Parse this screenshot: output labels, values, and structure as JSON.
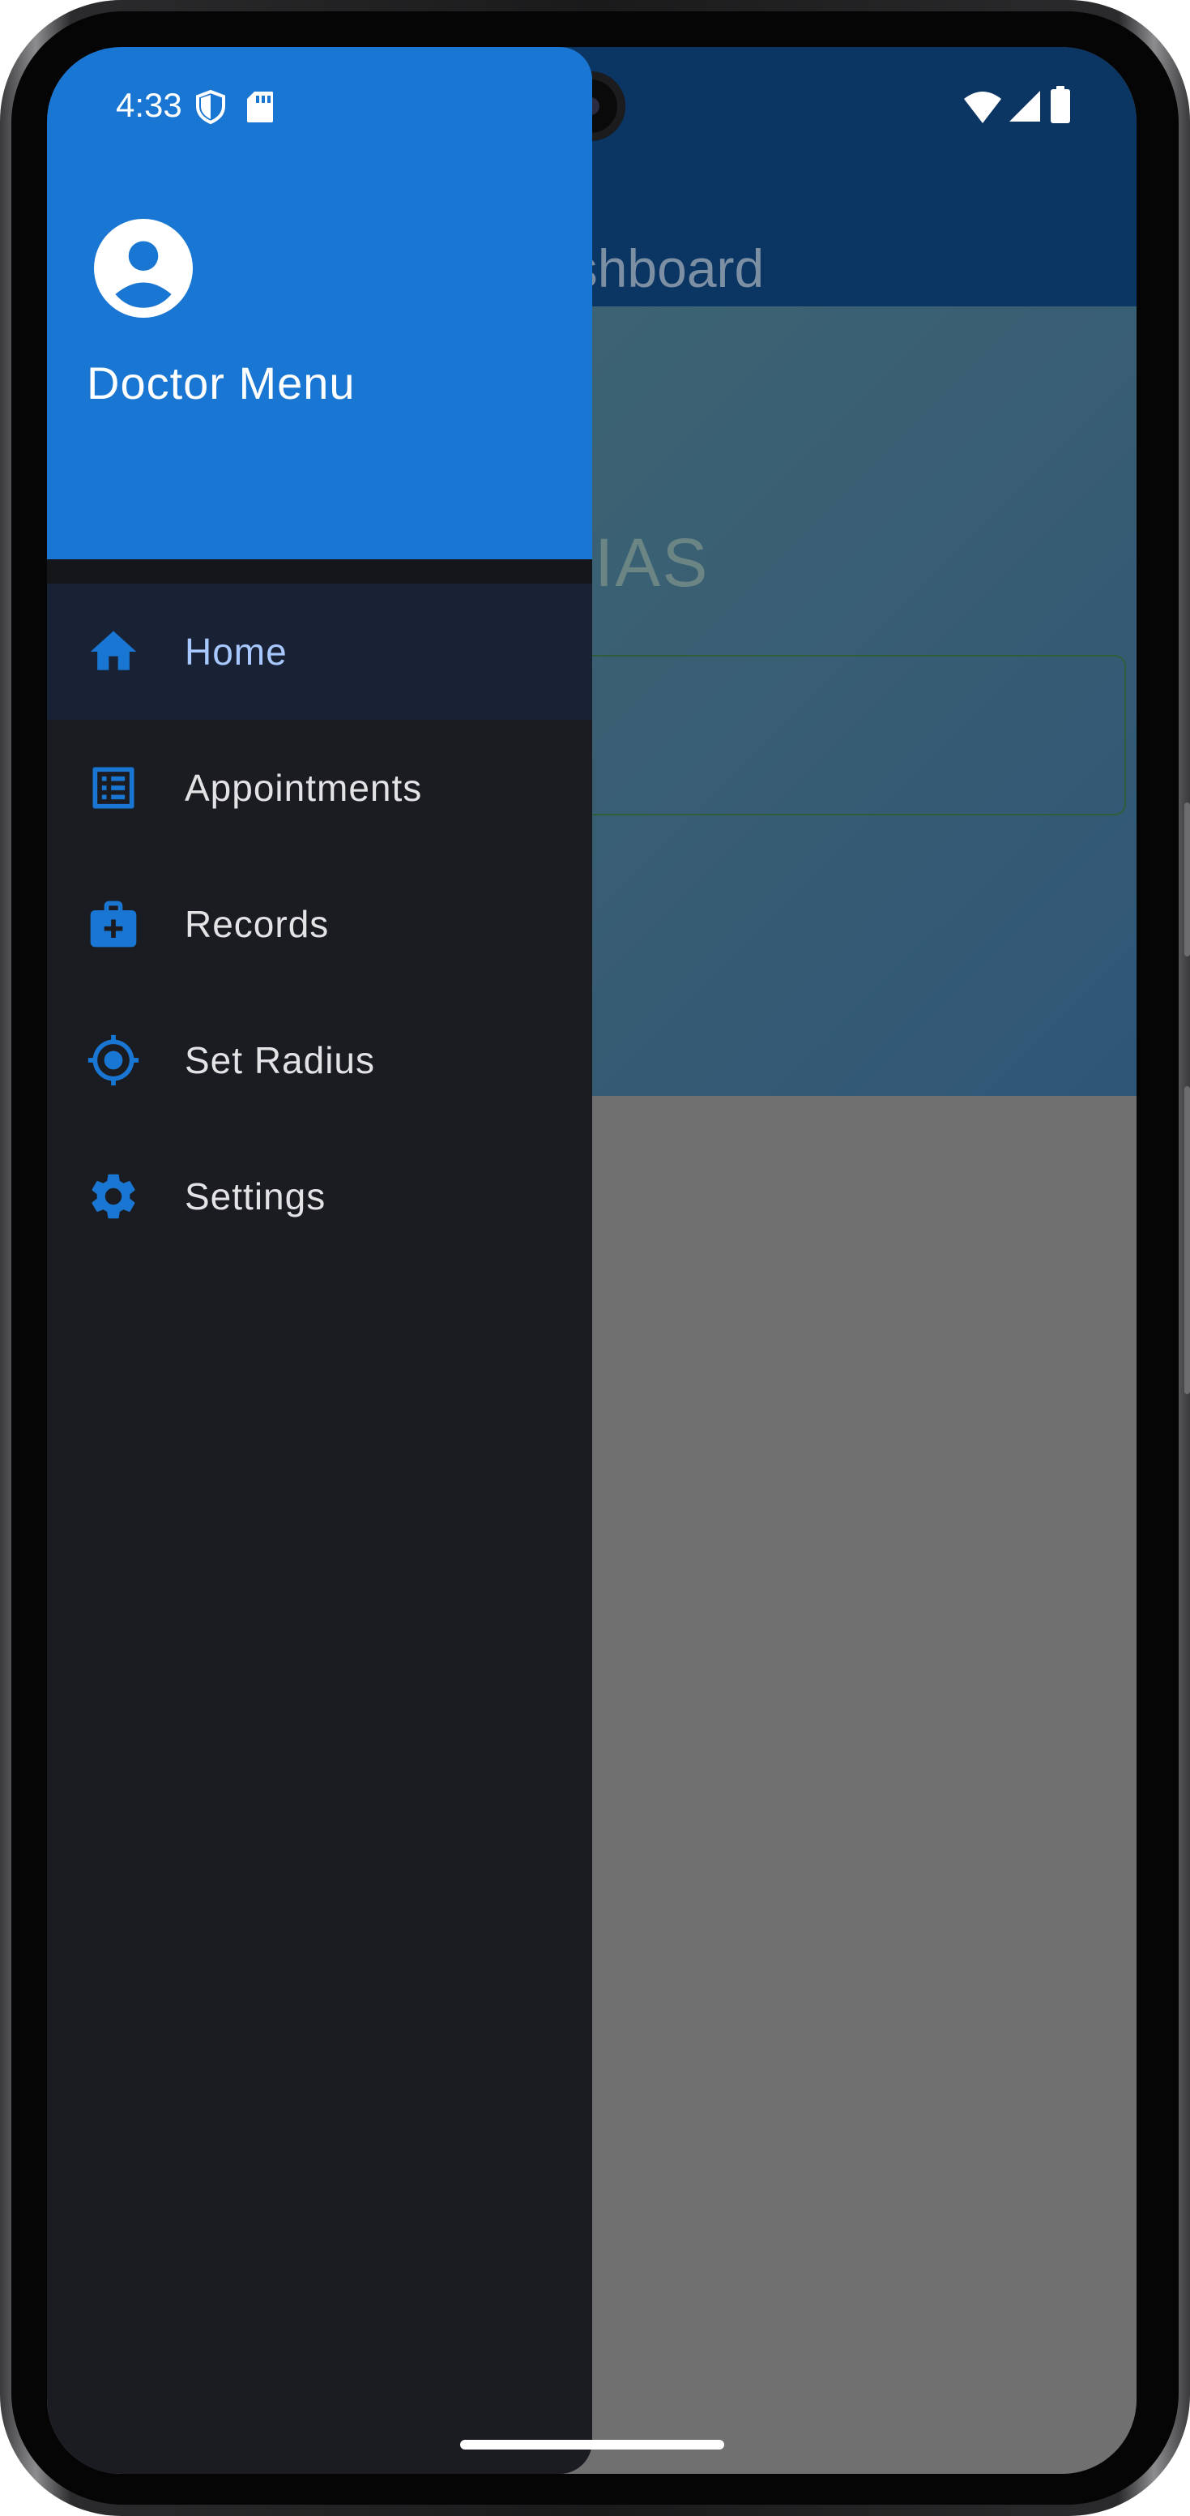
{
  "status_bar": {
    "time": "4:33",
    "icons": [
      "shield-icon",
      "sd-card-icon",
      "wifi-icon",
      "cell-signal-icon",
      "battery-icon"
    ]
  },
  "background_app": {
    "title": "Dashboard",
    "title_visible": "ashboard",
    "hero_name_visible": "THIAS"
  },
  "drawer": {
    "header_title": "Doctor Menu",
    "header_color": "#1976d2",
    "items": [
      {
        "label": "Home",
        "icon": "home-icon",
        "active": true
      },
      {
        "label": "Appointments",
        "icon": "list-icon",
        "active": false
      },
      {
        "label": "Records",
        "icon": "medical-bag-icon",
        "active": false
      },
      {
        "label": "Set Radius",
        "icon": "gps-target-icon",
        "active": false
      },
      {
        "label": "Settings",
        "icon": "gear-icon",
        "active": false
      }
    ]
  },
  "colors": {
    "accent": "#1976d2",
    "drawer_bg": "#1b1c21",
    "active_item_bg": "#182234",
    "active_label": "#a8c8ff"
  }
}
